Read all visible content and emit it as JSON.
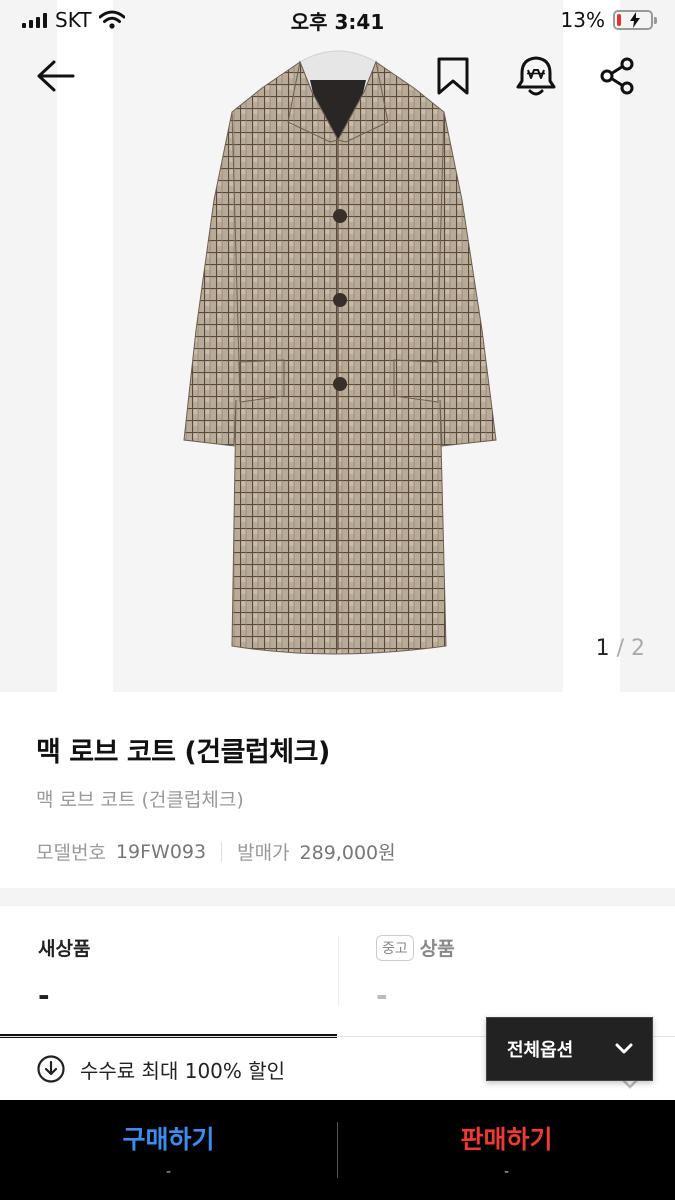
{
  "status_bar": {
    "carrier": "SKT",
    "time": "오후 3:41",
    "battery_percent": "13%",
    "battery_level": 0.13
  },
  "gallery": {
    "current": "1",
    "separator": "/",
    "total": "2"
  },
  "top_nav": {
    "icons": [
      "back-arrow-icon",
      "bookmark-icon",
      "price-alert-bell-icon",
      "share-icon"
    ]
  },
  "product": {
    "title": "맥 로브 코트 (건클럽체크)",
    "subtitle": "맥 로브 코트 (건클럽체크)",
    "model_label": "모델번호",
    "model_value": "19FW093",
    "release_price_label": "발매가",
    "release_price_value": "289,000원"
  },
  "tabs": {
    "new_label": "새상품",
    "new_price": "-",
    "used_chip": "중고",
    "used_label": "상품",
    "used_price": "-"
  },
  "options_button": {
    "label": "전체옵션"
  },
  "fee_banner": {
    "text": "수수료 최대 100% 할인"
  },
  "bottom_bar": {
    "buy_label": "구매하기",
    "buy_sub": "-",
    "sell_label": "판매하기",
    "sell_sub": "-"
  },
  "colors": {
    "buy": "#3d8df0",
    "sell": "#ee3b37",
    "bottom_bar_bg": "#000000",
    "battery_low": "#e5322d"
  }
}
